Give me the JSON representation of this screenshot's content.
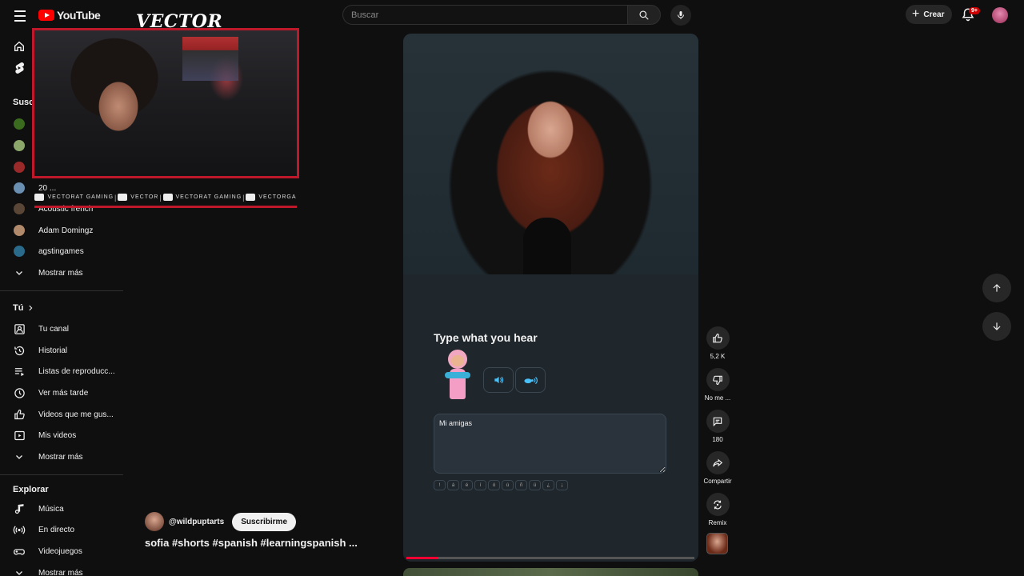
{
  "header": {
    "logo_text": "YouTube",
    "search_placeholder": "Buscar",
    "create_label": "Crear",
    "notifications_badge": "9+"
  },
  "sidebar": {
    "subscriptions_title": "Susc",
    "subscriptions": [
      {
        "label": ""
      },
      {
        "label": ""
      },
      {
        "label": ""
      },
      {
        "label": "20 ..."
      },
      {
        "label": "Acoustic french"
      },
      {
        "label": "Adam Domingz"
      },
      {
        "label": "agstingames"
      }
    ],
    "show_more_1": "Mostrar más",
    "you_title": "Tú",
    "you_items": [
      {
        "label": "Tu canal",
        "icon": "channel-icon"
      },
      {
        "label": "Historial",
        "icon": "history-icon"
      },
      {
        "label": "Listas de reproducc...",
        "icon": "playlists-icon"
      },
      {
        "label": "Ver más tarde",
        "icon": "watch-later-icon"
      },
      {
        "label": "Videos que me gus...",
        "icon": "liked-icon"
      },
      {
        "label": "Mis videos",
        "icon": "my-videos-icon"
      }
    ],
    "show_more_2": "Mostrar más",
    "explore_title": "Explorar",
    "explore_items": [
      {
        "label": "Música",
        "icon": "music-icon"
      },
      {
        "label": "En directo",
        "icon": "live-icon"
      },
      {
        "label": "Videojuegos",
        "icon": "gaming-icon"
      }
    ],
    "show_more_3": "Mostrar más"
  },
  "overlay": {
    "title": "VECTOR",
    "socials": [
      "VECTORAT GAMING",
      "VECTOR",
      "VECTORAT GAMING",
      "VECTORGA"
    ]
  },
  "short": {
    "duo_title": "Type what you hear",
    "answer_value": "Mi amigas",
    "special_keys": [
      "!",
      "á",
      "é",
      "í",
      "ó",
      "ú",
      "ñ",
      "ü",
      "¿",
      "¡"
    ],
    "progress": 0.11
  },
  "channel": {
    "handle": "@wildpuptarts",
    "subscribe_label": "Suscribirme",
    "tags": "sofia #shorts  #spanish  #learningspanish ..."
  },
  "actions": {
    "likes": "5,2 K",
    "dislike_label": "No me ...",
    "comments": "180",
    "share_label": "Compartir",
    "remix_label": "Remix"
  }
}
